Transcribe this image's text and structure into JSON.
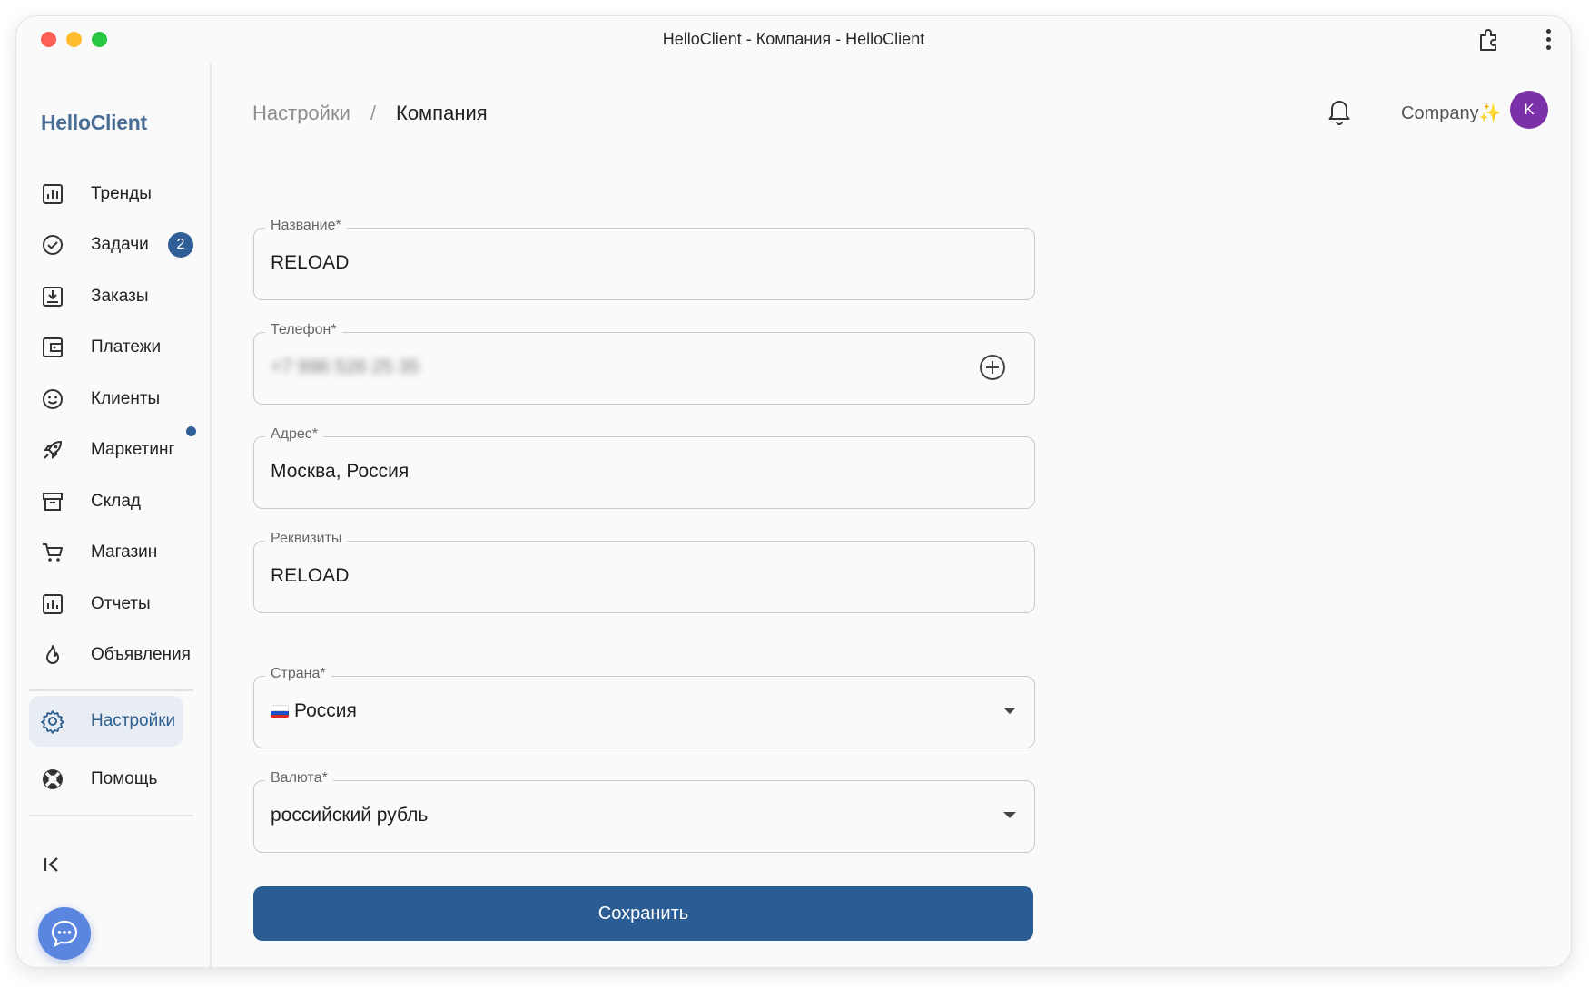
{
  "window": {
    "title": "HelloClient - Компания - HelloClient"
  },
  "sidebar": {
    "logo": "HelloClient",
    "items": [
      {
        "label": "Тренды",
        "icon": "chart-icon"
      },
      {
        "label": "Задачи",
        "icon": "check-circle-icon",
        "badge": "2"
      },
      {
        "label": "Заказы",
        "icon": "download-box-icon"
      },
      {
        "label": "Платежи",
        "icon": "wallet-icon"
      },
      {
        "label": "Клиенты",
        "icon": "smile-icon"
      },
      {
        "label": "Маркетинг",
        "icon": "rocket-icon",
        "dot": true
      },
      {
        "label": "Склад",
        "icon": "archive-icon"
      },
      {
        "label": "Магазин",
        "icon": "cart-icon"
      },
      {
        "label": "Отчеты",
        "icon": "report-chart-icon"
      },
      {
        "label": "Объявления",
        "icon": "fire-icon"
      },
      {
        "label": "Настройки",
        "icon": "gear-icon",
        "active": true
      },
      {
        "label": "Помощь",
        "icon": "lifebuoy-icon"
      }
    ],
    "colors": {
      "active_bg": "#e9eef4",
      "badge": "#2f5f96",
      "chat": "#5b86e0"
    }
  },
  "header": {
    "breadcrumb": [
      "Настройки",
      "Компания"
    ],
    "separator": "/",
    "account": "Company",
    "account_emoji": "✨",
    "avatar_letter": "K",
    "avatar_color": "#7b2fa8"
  },
  "form": {
    "name": {
      "label": "Название*",
      "value": "RELOAD"
    },
    "phone": {
      "label": "Телефон*",
      "value": "+7 996 526 25 35"
    },
    "address": {
      "label": "Адрес*",
      "value": "Москва, Россия"
    },
    "requisites": {
      "label": "Реквизиты",
      "value": "RELOAD"
    },
    "country": {
      "label": "Страна*",
      "value": "Россия",
      "flag": "ru-flag"
    },
    "currency": {
      "label": "Валюта*",
      "value": "российский рубль"
    },
    "save": "Сохранить",
    "save_color": "#2b5d95"
  }
}
